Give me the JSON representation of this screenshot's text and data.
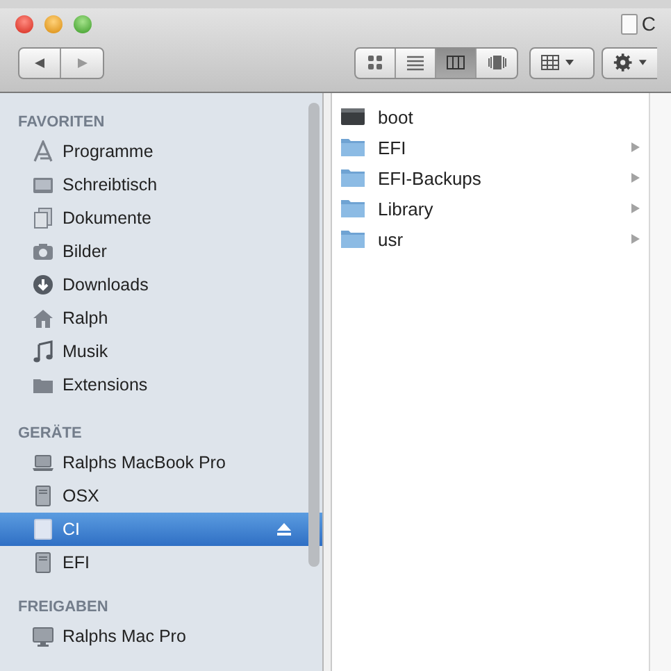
{
  "window": {
    "title": "C"
  },
  "toolbar": {
    "view_modes": [
      {
        "kind": "icons",
        "selected": false
      },
      {
        "kind": "list",
        "selected": false
      },
      {
        "kind": "columns",
        "selected": true
      },
      {
        "kind": "coverflow",
        "selected": false
      }
    ]
  },
  "sidebar": {
    "sections": [
      {
        "heading": "FAVORITEN",
        "items": [
          {
            "label": "Programme",
            "kind": "apps",
            "selected": false,
            "ejectable": false
          },
          {
            "label": "Schreibtisch",
            "kind": "desktop",
            "selected": false,
            "ejectable": false
          },
          {
            "label": "Dokumente",
            "kind": "documents",
            "selected": false,
            "ejectable": false
          },
          {
            "label": "Bilder",
            "kind": "pictures",
            "selected": false,
            "ejectable": false
          },
          {
            "label": "Downloads",
            "kind": "downloads",
            "selected": false,
            "ejectable": false
          },
          {
            "label": "Ralph",
            "kind": "home",
            "selected": false,
            "ejectable": false
          },
          {
            "label": "Musik",
            "kind": "music",
            "selected": false,
            "ejectable": false
          },
          {
            "label": "Extensions",
            "kind": "folder",
            "selected": false,
            "ejectable": false
          }
        ]
      },
      {
        "heading": "GERÄTE",
        "items": [
          {
            "label": "Ralphs MacBook Pro",
            "kind": "laptop",
            "selected": false,
            "ejectable": false
          },
          {
            "label": "OSX",
            "kind": "disk",
            "selected": false,
            "ejectable": false
          },
          {
            "label": "CI",
            "kind": "volume",
            "selected": true,
            "ejectable": true
          },
          {
            "label": "EFI",
            "kind": "disk",
            "selected": false,
            "ejectable": false
          }
        ]
      },
      {
        "heading": "FREIGABEN",
        "items": [
          {
            "label": "Ralphs Mac Pro",
            "kind": "display",
            "selected": false,
            "ejectable": false
          }
        ]
      }
    ]
  },
  "column": {
    "items": [
      {
        "name": "boot",
        "kind": "file",
        "has_children": false
      },
      {
        "name": "EFI",
        "kind": "folder",
        "has_children": true
      },
      {
        "name": "EFI-Backups",
        "kind": "folder",
        "has_children": true
      },
      {
        "name": "Library",
        "kind": "folder",
        "has_children": true
      },
      {
        "name": "usr",
        "kind": "folder",
        "has_children": true
      }
    ]
  }
}
